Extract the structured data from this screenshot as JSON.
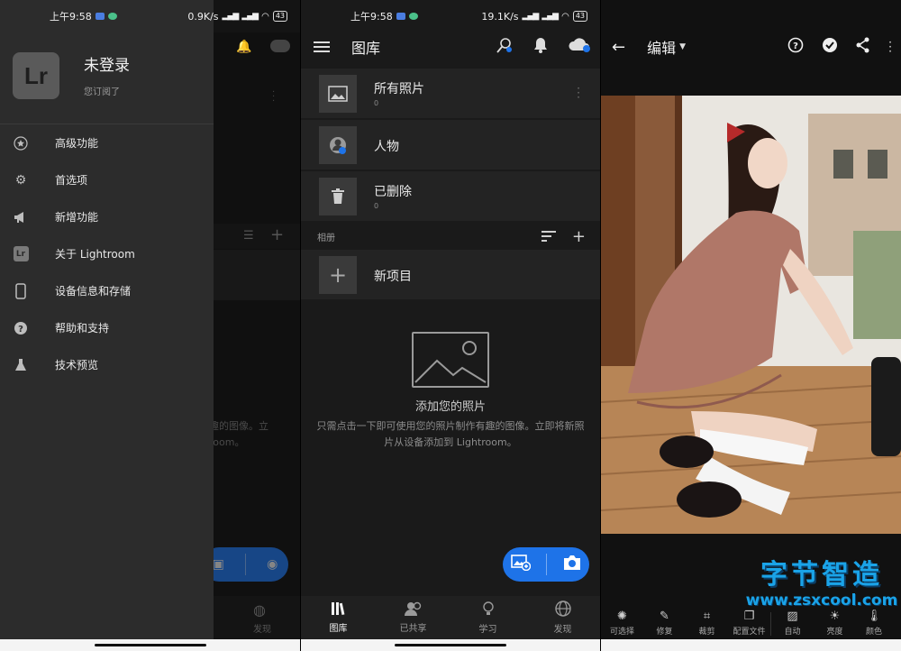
{
  "status_left": {
    "time": "上午9:58",
    "speed": "0.9K/s"
  },
  "status_mid": {
    "time": "上午9:58",
    "speed": "19.1K/s"
  },
  "battery": "43",
  "drawer": {
    "logo": "Lr",
    "user_name": "未登录",
    "user_sub": "您订阅了",
    "items": [
      {
        "icon": "star-icon",
        "label": "高级功能"
      },
      {
        "icon": "gear-icon",
        "label": "首选项"
      },
      {
        "icon": "megaphone-icon",
        "label": "新增功能"
      },
      {
        "icon": "lightroom-icon",
        "label": "关于 Lightroom"
      },
      {
        "icon": "phone-icon",
        "label": "设备信息和存储"
      },
      {
        "icon": "help-icon",
        "label": "帮助和支持"
      },
      {
        "icon": "flask-icon",
        "label": "技术预览"
      }
    ],
    "mini_logo": "Lr"
  },
  "library": {
    "title": "图库",
    "rows": [
      {
        "icon": "photos-icon",
        "title": "所有照片",
        "count": "0"
      },
      {
        "icon": "people-icon",
        "title": "人物",
        "count": ""
      },
      {
        "icon": "trash-icon",
        "title": "已删除",
        "count": "0"
      }
    ],
    "albums_label": "相册",
    "new_item": "新项目",
    "empty_title": "添加您的照片",
    "empty_desc": "只需点击一下即可使用您的照片制作有趣的图像。立即将新照片从设备添加到 Lightroom。",
    "bg_desc_fragment_1": "趣的图像。立",
    "bg_desc_fragment_2": "room。"
  },
  "bottom_nav": [
    {
      "icon": "library-icon",
      "label": "图库"
    },
    {
      "icon": "shared-icon",
      "label": "已共享"
    },
    {
      "icon": "learn-icon",
      "label": "学习"
    },
    {
      "icon": "discover-icon",
      "label": "发现"
    }
  ],
  "editor": {
    "title": "编辑",
    "tools": [
      {
        "icon": "selective-icon",
        "label": "可选择"
      },
      {
        "icon": "healing-icon",
        "label": "修复"
      },
      {
        "icon": "crop-icon",
        "label": "裁剪"
      },
      {
        "icon": "profile-icon",
        "label": "配置文件"
      },
      {
        "icon": "auto-icon",
        "label": "自动"
      },
      {
        "icon": "light-icon",
        "label": "亮度"
      },
      {
        "icon": "color-icon",
        "label": "颜色"
      }
    ]
  },
  "watermark": {
    "cn": "字节智造",
    "url": "www.zsxcool.com"
  },
  "colors": {
    "accent": "#1e73e8",
    "drawer_bg": "#2c2c2c",
    "watermark": "#1aa3e8"
  }
}
